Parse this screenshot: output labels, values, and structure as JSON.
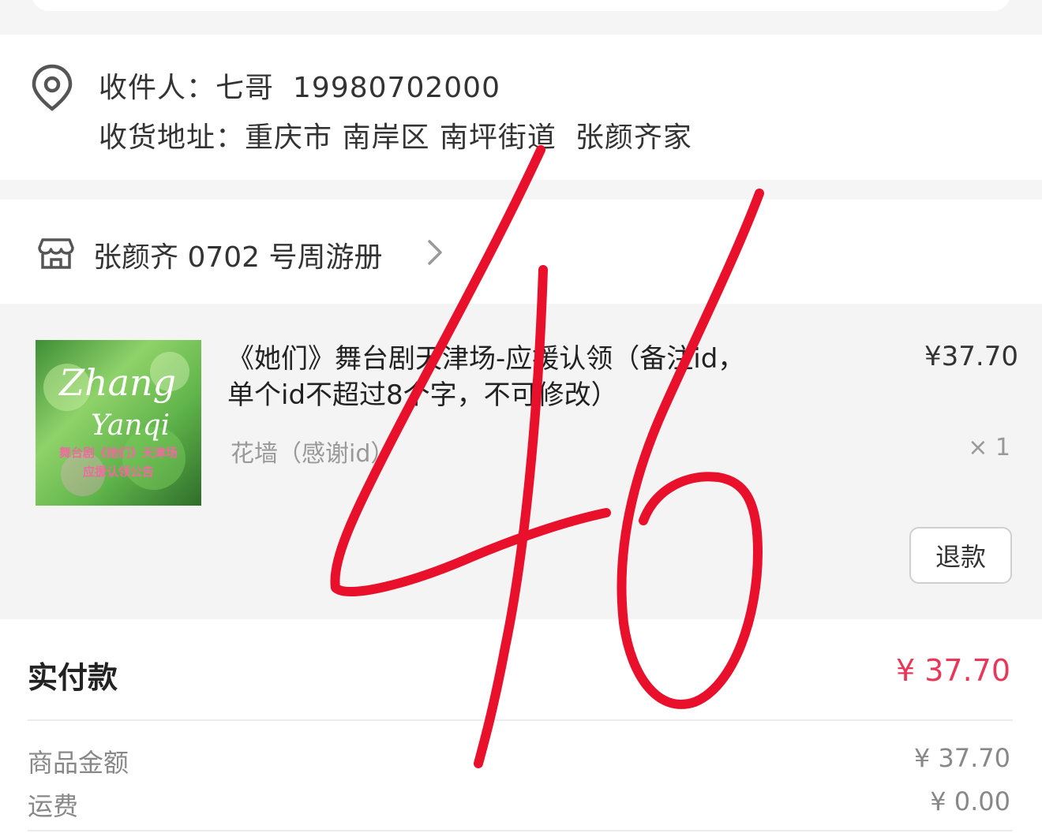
{
  "address": {
    "recipient_label": "收件人：",
    "recipient_name": "七哥",
    "phone": "19980702000",
    "address_label": "收货地址：",
    "address_value": "重庆市 南岸区 南坪街道",
    "address_detail": "张颜齐家"
  },
  "shop": {
    "name": "张颜齐 0702 号周游册"
  },
  "product": {
    "title": "《她们》舞台剧天津场-应援认领（备注id，单个id不超过8个字，不可修改）",
    "price": "¥37.70",
    "spec": "花墙（感谢id）",
    "quantity": "× 1",
    "refund_label": "退款",
    "thumbnail": {
      "line1": "Zhang",
      "line2": "Yanqi",
      "caption1": "舞台剧《她们》天津场",
      "caption2": "应援认领公告"
    }
  },
  "payment": {
    "paid_label": "实付款",
    "paid_value": "¥ 37.70",
    "goods_amount_label": "商品金额",
    "goods_amount_value": "¥ 37.70",
    "shipping_label": "运费",
    "shipping_value": "¥ 0.00"
  },
  "annotation": {
    "handwritten_text": "46"
  },
  "colors": {
    "accent_price": "#e8385a",
    "annotation_red": "#e8102a"
  }
}
